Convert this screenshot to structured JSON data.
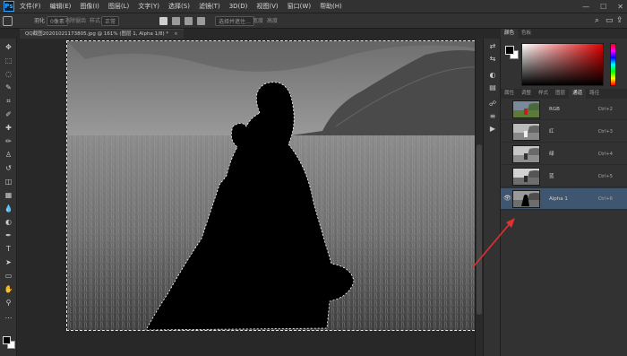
{
  "app": {
    "logo": "Ps"
  },
  "menu": [
    "文件(F)",
    "编辑(E)",
    "图像(I)",
    "图层(L)",
    "文字(Y)",
    "选择(S)",
    "滤镜(T)",
    "3D(D)",
    "视图(V)",
    "窗口(W)",
    "帮助(H)"
  ],
  "window_controls": {
    "minimize": "—",
    "maximize": "☐",
    "close": "✕"
  },
  "options": {
    "feather_label": "羽化",
    "feather_value": "0像素",
    "smooth_label": "消除锯齿",
    "style_label": "样式",
    "style_value": "正常",
    "width_label": "宽度",
    "height_label": "高度",
    "refine_label": "选择并遮住…",
    "search_icon": "⌕",
    "workspace_icon": "▭",
    "share_icon": "⇪"
  },
  "document": {
    "tab_title": "QQ截图20201021173805.jpg @ 161% (图层 1, Alpha 1/8) *",
    "close": "×"
  },
  "tools": [
    "move-icon",
    "marquee-icon",
    "lasso-icon",
    "quick-select-icon",
    "crop-icon",
    "eyedropper-icon",
    "healing-icon",
    "brush-icon",
    "stamp-icon",
    "history-brush-icon",
    "eraser-icon",
    "gradient-icon",
    "blur-icon",
    "dodge-icon",
    "pen-icon",
    "type-icon",
    "path-select-icon",
    "shape-icon",
    "hand-icon",
    "zoom-icon",
    "more-icon"
  ],
  "tool_glyphs": [
    "✥",
    "⬚",
    "◌",
    "✎",
    "⌗",
    "✐",
    "✚",
    "✏",
    "♙",
    "↺",
    "◫",
    "▦",
    "💧",
    "◐",
    "✒",
    "T",
    "➤",
    "▭",
    "✋",
    "⚲",
    "…"
  ],
  "panels": {
    "color_tabs": [
      "颜色",
      "色板"
    ],
    "channel_tabs": [
      "属性",
      "调整",
      "样式",
      "图层",
      "通道",
      "路径"
    ],
    "channels": [
      {
        "name": "RGB",
        "shortcut": "Ctrl+2",
        "visible": false,
        "selected": false
      },
      {
        "name": "红",
        "shortcut": "Ctrl+3",
        "visible": false,
        "selected": false
      },
      {
        "name": "绿",
        "shortcut": "Ctrl+4",
        "visible": false,
        "selected": false
      },
      {
        "name": "蓝",
        "shortcut": "Ctrl+5",
        "visible": false,
        "selected": false
      },
      {
        "name": "Alpha 1",
        "shortcut": "Ctrl+6",
        "visible": true,
        "selected": true
      }
    ],
    "eye_glyph": "👁"
  },
  "iconstrip": [
    "⇄",
    "⇆",
    "◐",
    "▤",
    "☍",
    "≡",
    "▶"
  ],
  "colors": {
    "accent": "#31a8ff",
    "selected_row": "#3f5670",
    "arrow": "#e03030"
  }
}
